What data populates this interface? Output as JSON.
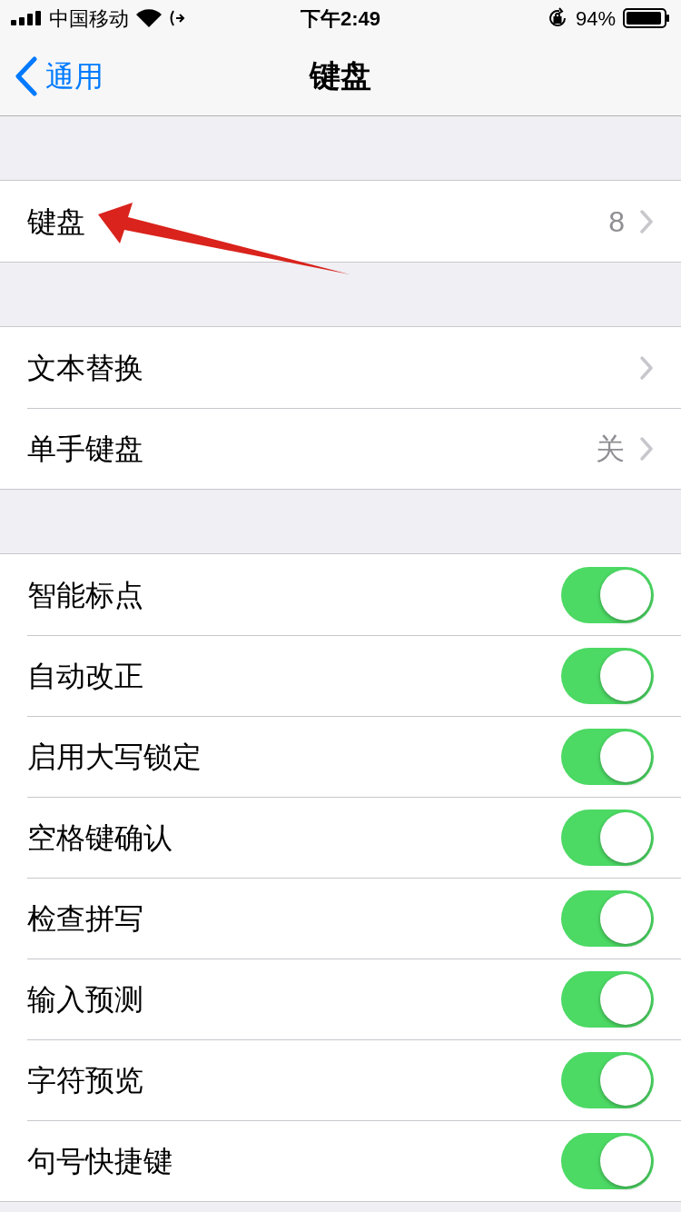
{
  "status_bar": {
    "carrier": "中国移动",
    "time": "下午2:49",
    "battery": "94%"
  },
  "nav": {
    "back": "通用",
    "title": "键盘"
  },
  "groups": [
    {
      "rows": [
        {
          "kind": "link",
          "label": "键盘",
          "value": "8"
        }
      ]
    },
    {
      "rows": [
        {
          "kind": "link",
          "label": "文本替换"
        },
        {
          "kind": "link",
          "label": "单手键盘",
          "value": "关"
        }
      ]
    },
    {
      "rows": [
        {
          "kind": "toggle",
          "label": "智能标点",
          "on": true
        },
        {
          "kind": "toggle",
          "label": "自动改正",
          "on": true
        },
        {
          "kind": "toggle",
          "label": "启用大写锁定",
          "on": true
        },
        {
          "kind": "toggle",
          "label": "空格键确认",
          "on": true
        },
        {
          "kind": "toggle",
          "label": "检查拼写",
          "on": true
        },
        {
          "kind": "toggle",
          "label": "输入预测",
          "on": true
        },
        {
          "kind": "toggle",
          "label": "字符预览",
          "on": true
        },
        {
          "kind": "toggle",
          "label": "句号快捷键",
          "on": true
        }
      ]
    }
  ]
}
